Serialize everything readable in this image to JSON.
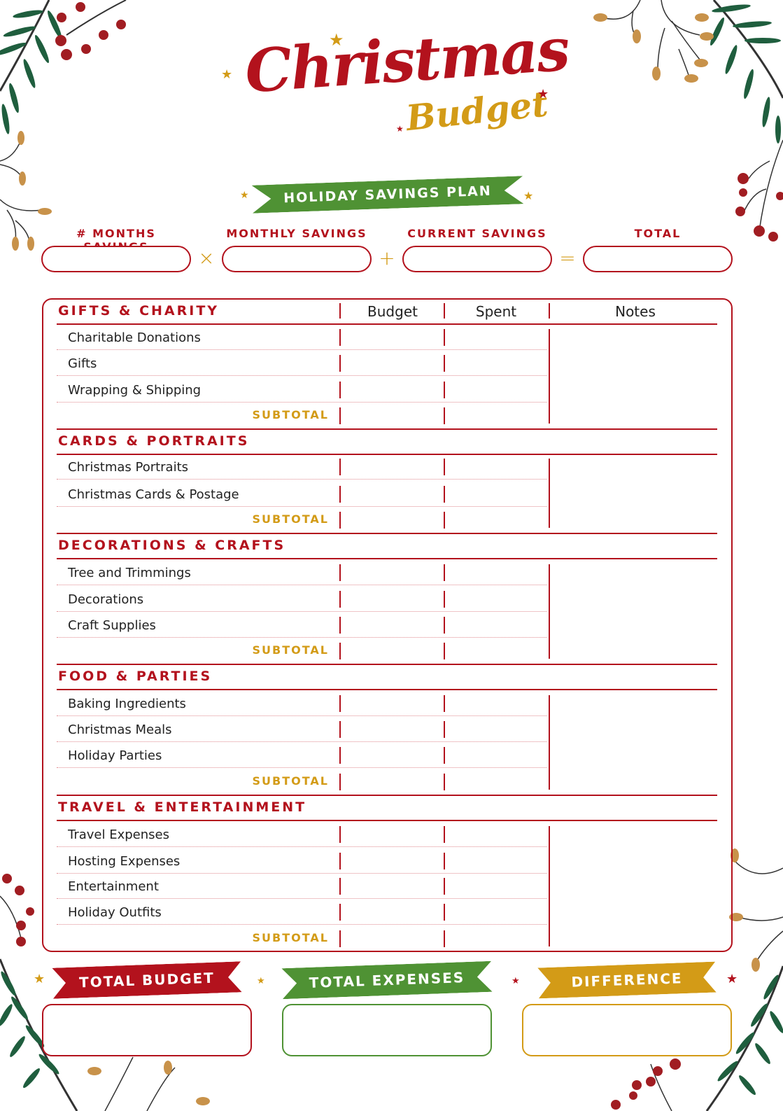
{
  "header": {
    "title": "Christmas",
    "subtitle": "Budget"
  },
  "savings_plan": {
    "banner": "HOLIDAY SAVINGS PLAN",
    "fields": [
      {
        "label": "# MONTHS SAVINGS",
        "value": ""
      },
      {
        "label": "MONTHLY SAVINGS",
        "value": ""
      },
      {
        "label": "CURRENT SAVINGS",
        "value": ""
      },
      {
        "label": "TOTAL",
        "value": ""
      }
    ],
    "operators": [
      "×",
      "+",
      "="
    ]
  },
  "table": {
    "columns": [
      "Budget",
      "Spent",
      "Notes"
    ],
    "subtotal_label": "SUBTOTAL",
    "sections": [
      {
        "title": "GIFTS & CHARITY",
        "items": [
          "Charitable Donations",
          "Gifts",
          "Wrapping & Shipping"
        ]
      },
      {
        "title": "CARDS & PORTRAITS",
        "items": [
          "Christmas Portraits",
          "Christmas Cards & Postage"
        ]
      },
      {
        "title": "DECORATIONS & CRAFTS",
        "items": [
          "Tree and Trimmings",
          "Decorations",
          "Craft Supplies"
        ]
      },
      {
        "title": "FOOD & PARTIES",
        "items": [
          "Baking Ingredients",
          "Christmas Meals",
          "Holiday Parties"
        ]
      },
      {
        "title": "TRAVEL & ENTERTAINMENT",
        "items": [
          "Travel Expenses",
          "Hosting Expenses",
          "Entertainment",
          "Holiday Outfits"
        ]
      }
    ]
  },
  "totals": [
    {
      "label": "TOTAL BUDGET",
      "value": "",
      "color": "#b3121d"
    },
    {
      "label": "TOTAL EXPENSES",
      "value": "",
      "color": "#4f9234"
    },
    {
      "label": "DIFFERENCE",
      "value": "",
      "color": "#d39b17"
    }
  ],
  "colors": {
    "red": "#b3121d",
    "green": "#4f9234",
    "gold": "#d39b17",
    "pine": "#1f5e3e"
  },
  "icons": {
    "star": "★"
  }
}
